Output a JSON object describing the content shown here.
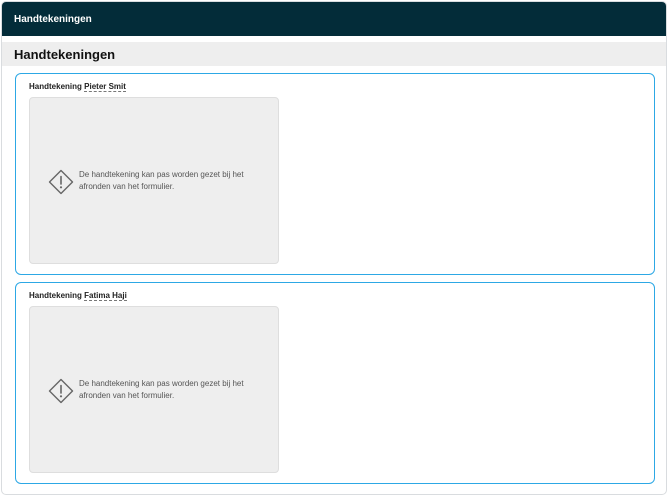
{
  "topbar": {
    "title": "Handtekeningen"
  },
  "section": {
    "title": "Handtekeningen"
  },
  "signatures": [
    {
      "label_prefix": "Handtekening",
      "name": "Pieter Smit",
      "message": "De handtekening kan pas worden gezet bij het afronden van het formulier.",
      "icon": "warning-diamond-icon"
    },
    {
      "label_prefix": "Handtekening",
      "name": "Fatima Haji",
      "message": "De handtekening kan pas worden gezet bij het afronden van het formulier.",
      "icon": "warning-diamond-icon"
    }
  ],
  "colors": {
    "topbar_bg": "#032c39",
    "card_border": "#2da8e5",
    "pad_bg": "#eeeeee"
  }
}
